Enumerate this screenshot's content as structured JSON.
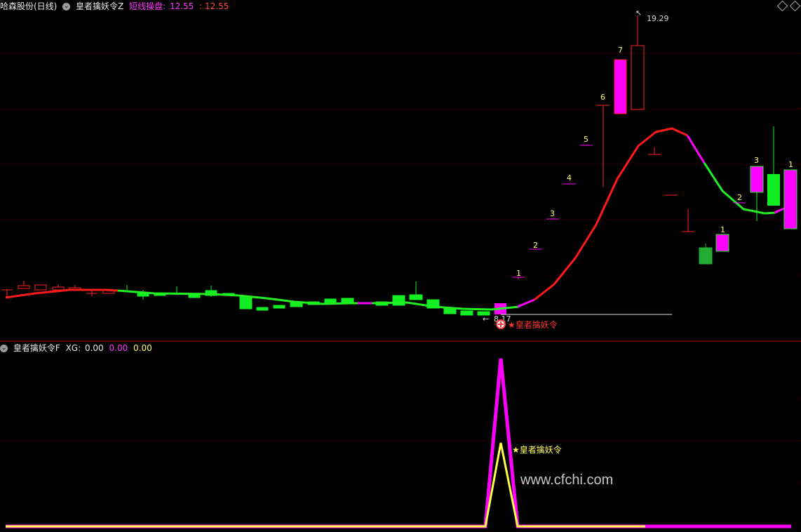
{
  "main_header": {
    "stock": "哈森股份(日线)",
    "indicator": "皇者擒妖令Z",
    "line_label": "短线操盘:",
    "value1": "12.55",
    "value2": "12.55"
  },
  "sub_header": {
    "indicator": "皇者擒妖令F",
    "xg_label": "XG:",
    "xg_value": "0.00",
    "v2": "0.00",
    "v3": "0.00"
  },
  "annotations": {
    "high_price": "19.29",
    "low_price": "8.17",
    "signal_main": "★皇者擒妖令",
    "signal_sub": "★皇者擒妖令",
    "count_up": [
      "1",
      "2",
      "3",
      "4",
      "5",
      "6",
      "7"
    ],
    "count_down": [
      "1",
      "2",
      "3",
      "1"
    ]
  },
  "watermark": "www.cfchi.com",
  "colors": {
    "background": "#000000",
    "up": "#ff00ff",
    "down": "#00ff00",
    "ma_red": "#ff1a1a",
    "ma_green": "#22ee22",
    "ma_magenta": "#ff00ff",
    "yellow": "#ffff55",
    "grid": "#8b0000"
  },
  "chart_data": {
    "type": "candlestick",
    "price_high": 19.29,
    "price_low": 8.17,
    "sub_series": [
      {
        "name": "XG",
        "type": "line",
        "peak": 1
      },
      {
        "name": "",
        "type": "line",
        "peak": 2
      }
    ]
  }
}
